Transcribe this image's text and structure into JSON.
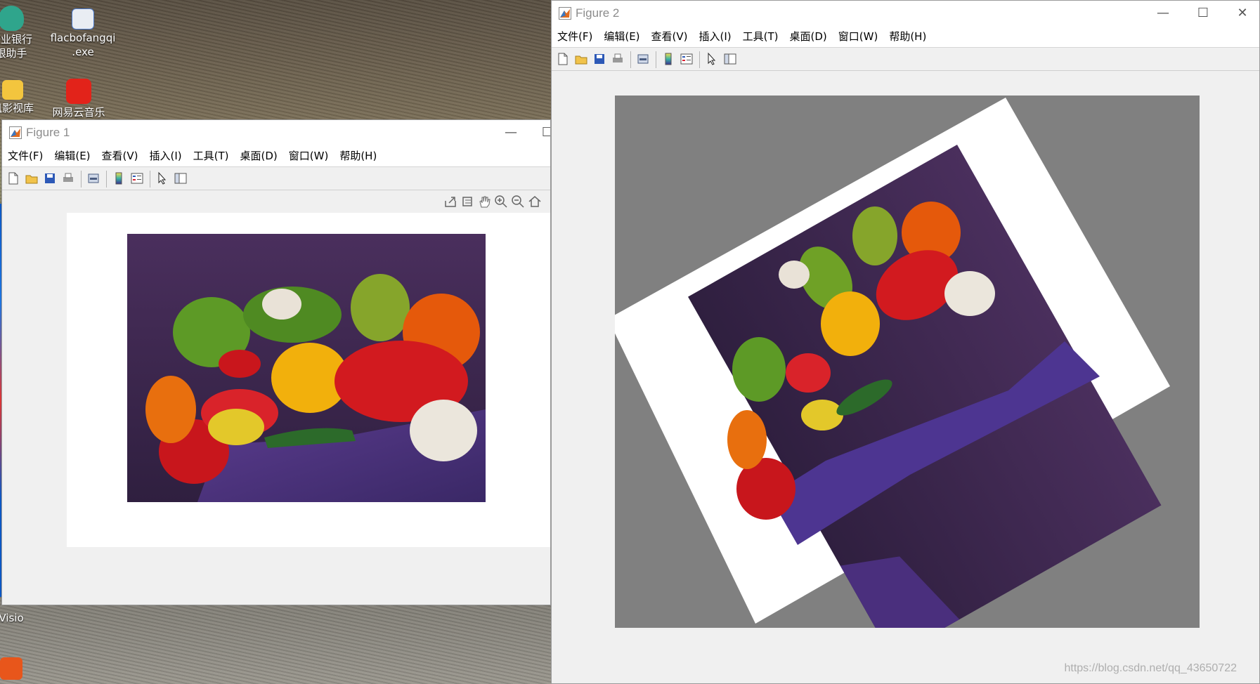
{
  "desktop": {
    "icons": [
      {
        "label_line1": "农业银行",
        "label_line2": "银助手"
      },
      {
        "label_line1": "flacbofangqi",
        "label_line2": ".exe"
      },
      {
        "label_line1": "讯影视库",
        "label_line2": ""
      },
      {
        "label_line1": "网易云音乐",
        "label_line2": ""
      },
      {
        "label_line1": "Visio",
        "label_line2": ""
      }
    ]
  },
  "figure1": {
    "title": "Figure 1",
    "menu": [
      "文件(F)",
      "编辑(E)",
      "查看(V)",
      "插入(I)",
      "工具(T)",
      "桌面(D)",
      "窗口(W)",
      "帮助(H)"
    ],
    "toolbar_icons": [
      "new-file-icon",
      "open-folder-icon",
      "save-icon",
      "print-icon",
      "print-preview-icon",
      "colorbar-icon",
      "legend-icon",
      "pointer-icon",
      "property-editor-icon"
    ],
    "axes_toolbar_icons": [
      "export-icon",
      "brush-icon",
      "pan-hand-icon",
      "zoom-in-icon",
      "zoom-out-icon",
      "home-icon"
    ],
    "image": "peppers"
  },
  "figure2": {
    "title": "Figure 2",
    "menu": [
      "文件(F)",
      "编辑(E)",
      "查看(V)",
      "插入(I)",
      "工具(T)",
      "桌面(D)",
      "窗口(W)",
      "帮助(H)"
    ],
    "toolbar_icons": [
      "new-file-icon",
      "open-folder-icon",
      "save-icon",
      "print-icon",
      "print-preview-icon",
      "colorbar-icon",
      "legend-icon",
      "pointer-icon",
      "property-editor-icon"
    ],
    "image": "peppers rotated"
  },
  "watermark": "https://blog.csdn.net/qq_43650722",
  "colors": {
    "figure_bg": "#f0f0f0",
    "axes_gray": "#808080",
    "title_gray": "#8c8c8c"
  }
}
